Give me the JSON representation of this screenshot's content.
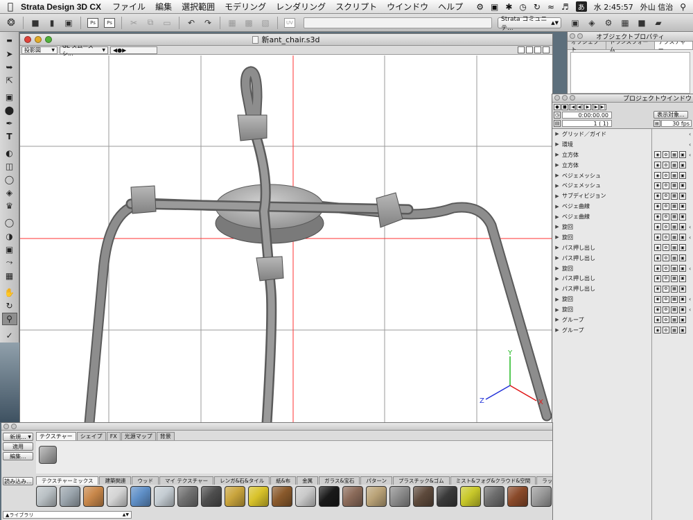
{
  "menubar": {
    "app_name": "Strata Design 3D CX",
    "menus": [
      "ファイル",
      "編集",
      "選択範囲",
      "モデリング",
      "レンダリング",
      "スクリプト",
      "ウインドウ",
      "ヘルプ"
    ],
    "clock": "水 2:45:57",
    "user": "外山 信治",
    "ime": "あ",
    "status_icons": [
      "scripts-icon",
      "display-icon",
      "bluetooth-icon",
      "time-machine-icon",
      "sync-icon",
      "wifi-icon",
      "volume-icon",
      "search-icon"
    ]
  },
  "toolbar": {
    "community_label": "Strata コミュニテ..."
  },
  "document": {
    "title": "新ant_chair.s3d",
    "view_mode": "投影図",
    "render_mode": "GL スムースシ..."
  },
  "object_properties": {
    "title": "オブジェクトプロパティ",
    "tabs": [
      "オブジェクト",
      "トランスフォーム",
      "テクスチャー"
    ],
    "selected_tab": 2
  },
  "project_window": {
    "title": "プロジェクトウインドウ",
    "timecode": "0:00:00.00",
    "frame": "1 ( 1)",
    "display_button": "表示対象...",
    "fps": "30 fps",
    "items": [
      {
        "name": "グリッド／ガイド",
        "icons": 0,
        "chev": true
      },
      {
        "name": "環境",
        "icons": 0,
        "chev": true
      },
      {
        "name": "立方体",
        "icons": 4,
        "chev": true
      },
      {
        "name": "立方体",
        "icons": 4,
        "chev": false
      },
      {
        "name": "ベジェメッシュ",
        "icons": 4,
        "chev": false
      },
      {
        "name": "ベジェメッシュ",
        "icons": 4,
        "chev": false
      },
      {
        "name": "サブディビジョン",
        "icons": 4,
        "chev": false
      },
      {
        "name": "ベジェ曲線",
        "icons": 4,
        "chev": false
      },
      {
        "name": "ベジェ曲線",
        "icons": 4,
        "chev": false
      },
      {
        "name": "旋回",
        "icons": 4,
        "chev": true
      },
      {
        "name": "旋回",
        "icons": 4,
        "chev": true
      },
      {
        "name": "パス押し出し",
        "icons": 4,
        "chev": false
      },
      {
        "name": "パス押し出し",
        "icons": 4,
        "chev": false
      },
      {
        "name": "旋回",
        "icons": 4,
        "chev": true
      },
      {
        "name": "パス押し出し",
        "icons": 4,
        "chev": false
      },
      {
        "name": "パス押し出し",
        "icons": 4,
        "chev": false
      },
      {
        "name": "旋回",
        "icons": 4,
        "chev": true
      },
      {
        "name": "旋回",
        "icons": 4,
        "chev": true
      },
      {
        "name": "グループ",
        "icons": 4,
        "chev": false
      },
      {
        "name": "グループ",
        "icons": 4,
        "chev": false
      }
    ]
  },
  "resource_palette": {
    "side_buttons": [
      "新規...",
      "適用",
      "編集..."
    ],
    "load_button": "読み込み...",
    "tabs": [
      "テクスチャー",
      "シェイプ",
      "FX",
      "光源マップ",
      "背景"
    ],
    "selected_tab": 0,
    "library_tabs": [
      "テクスチャーミックス",
      "建築関連",
      "ウッド",
      "マイ テクスチャー",
      "レンガ&石&タイル",
      "紙&布",
      "金属",
      "ガラス&宝石",
      "パターン",
      "プラスチック&ゴム",
      "ミスト&フォグ&クラウド&空間",
      "ラップ&コーティング"
    ],
    "library_selected": 0,
    "library_select": "ライブラリ",
    "swatch_colors": [
      "#b9c0c4",
      "#9ba5ad",
      "#c8874a",
      "#d4d4d4",
      "#5f8fc7",
      "#c4ccd2",
      "#707070",
      "#4e4e4e",
      "#c9a43c",
      "#d8c22a",
      "#8a5a2c",
      "#c9c9c9",
      "#1a1a1a",
      "#8b6b5a",
      "#b9a277",
      "#8c8c8c",
      "#5e4a3c",
      "#3a3a3a",
      "#c8c82a",
      "#6e6e6e",
      "#8a4a2a",
      "#9a9a9a"
    ]
  },
  "viewport": {
    "axis_labels": {
      "x": "X",
      "y": "Y",
      "z": "Z"
    },
    "colors": {
      "x": "#e01818",
      "y": "#1db81d",
      "z": "#2030d8",
      "guide": "#ff3030",
      "grid": "#9a9a9a"
    }
  }
}
